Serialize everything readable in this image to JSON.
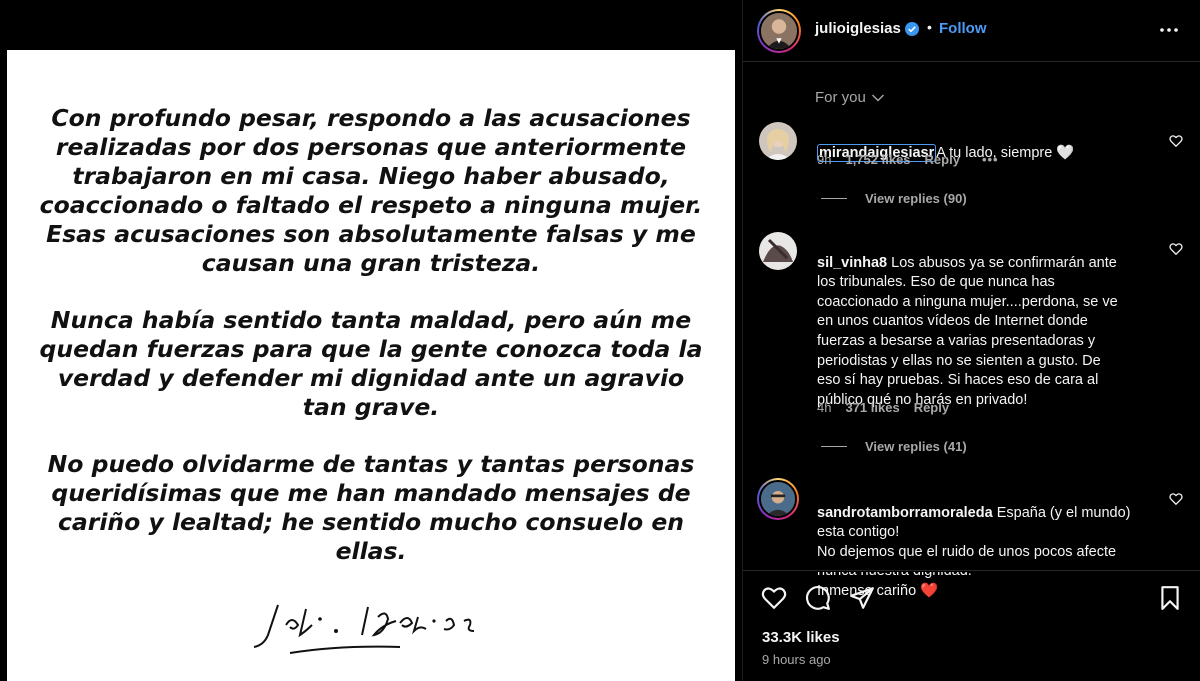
{
  "post_image": {
    "paragraphs": [
      "Con profundo pesar, respondo a las acusaciones\nrealizadas por dos personas que anteriormente\ntrabajaron en mi casa. Niego haber abusado,\ncoaccionado o faltado el respeto a ninguna mujer.\nEsas acusaciones son absolutamente falsas y me\ncausan una gran tristeza.",
      "Nunca había sentido tanta maldad, pero aún me\nquedan fuerzas para que la gente conozca toda la\nverdad y defender mi dignidad ante un agravio\ntan grave.",
      "No puedo olvidarme de tantas y tantas personas\nqueridísimas que me han mandado mensajes de\ncariño y lealtad; he sentido mucho consuelo en\nellas."
    ],
    "signature": "Julio Iglesias"
  },
  "header": {
    "username": "julioiglesias",
    "separator": "•",
    "follow_label": "Follow",
    "verified_color": "#3897f0"
  },
  "sort": {
    "label": "For you"
  },
  "comments": [
    {
      "username": "mirandaiglesiasr",
      "text": "A tu lado, siempre 🤍",
      "time": "9h",
      "likes": "1,752 likes",
      "reply": "Reply",
      "more": "•••",
      "view_replies": "View replies (90)"
    },
    {
      "username": "sil_vinha8",
      "text": "Los abusos ya se confirmarán ante\nlos tribunales. Eso de que nunca has\ncoaccionado a ninguna mujer....perdona, se ve\nen unos cuantos vídeos de Internet donde\nfuerzas a besarse a varias presentadoras y\nperiodistas y ellas no se sienten a gusto. De\neso sí hay pruebas. Si haces eso de cara al\npúblico qué no harás en privado!",
      "time": "4h",
      "likes": "371 likes",
      "reply": "Reply",
      "view_replies": "View replies (41)"
    },
    {
      "username": "sandrotamborramoraleda",
      "text": "España (y el mundo)\nesta contigo!\nNo dejemos que el ruido de unos pocos afecte\nnunca nuestra dignidad.\nInmenso cariño ❤️"
    }
  ],
  "footer": {
    "likes": "33.3K likes",
    "time": "9 hours ago"
  },
  "colors": {
    "accent": "#4d9bf6",
    "background": "#000000",
    "muted_text": "#a8a8a8"
  }
}
